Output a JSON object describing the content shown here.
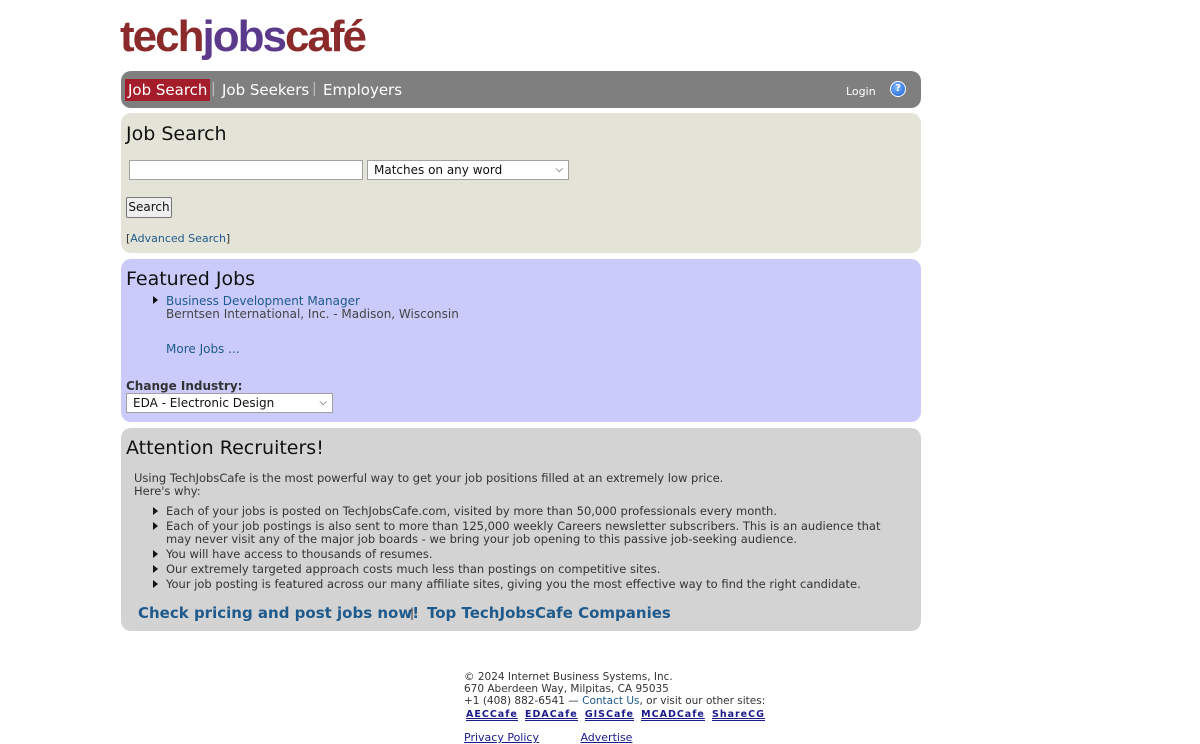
{
  "logo": {
    "part1": "tech",
    "part2": "jobs",
    "part3": "café"
  },
  "nav": {
    "items": [
      "Job Search",
      "Job Seekers",
      "Employers"
    ],
    "separator": "|",
    "login": "Login",
    "help": "?"
  },
  "search": {
    "title": "Job Search",
    "input_value": "",
    "match_option": "Matches on any word",
    "button": "Search",
    "advanced_open": "[",
    "advanced_link": "Advanced Search",
    "advanced_close": "]"
  },
  "featured": {
    "title": "Featured Jobs",
    "job_title": "Business Development Manager",
    "job_company": "Berntsen International, Inc. - Madison, Wisconsin",
    "more_jobs": "More Jobs ...",
    "change_label": "Change Industry:",
    "industry": "EDA - Electronic Design"
  },
  "recruiters": {
    "title": "Attention Recruiters!",
    "intro_1": "Using TechJobsCafe is the most powerful way to get your job positions filled at an extremely low price.",
    "intro_2": "Here's why:",
    "reasons": [
      "Each of your jobs is posted on TechJobsCafe.com, visited by more than 50,000 professionals every month.",
      "Each of your job postings is also sent to more than 125,000 weekly Careers newsletter subscribers. This is an audience that may never visit any of the major job boards - we bring your job opening to this passive job-seeking audience.",
      "You will have access to thousands of resumes.",
      "Our extremely targeted approach costs much less than postings on competitive sites.",
      "Your job posting is featured across our many affiliate sites, giving you the most effective way to find the right candidate."
    ],
    "cta_pricing": "Check pricing and post jobs now!",
    "cta_separator": "|",
    "cta_companies": "Top TechJobsCafe Companies"
  },
  "footer": {
    "copyright": "© 2024 Internet Business Systems, Inc.",
    "address": "670 Aberdeen Way, Milpitas, CA 95035",
    "phone": "+1 (408) 882-6541 —",
    "contact": "Contact Us",
    "visit": ", or visit our other sites:",
    "sites": [
      "AECCafe",
      "EDACafe",
      "GISCafe",
      "MCADCafe",
      "ShareCG"
    ],
    "privacy": "Privacy Policy",
    "advertise": "Advertise"
  },
  "colors": {
    "nav_bg": "#7f7f7f",
    "nav_active": "#a51d2a",
    "search_panel": "#e3e3d7",
    "featured_panel": "#cbcbfb",
    "recruit_panel": "#d3d3d3",
    "link": "#1f5a8c"
  }
}
